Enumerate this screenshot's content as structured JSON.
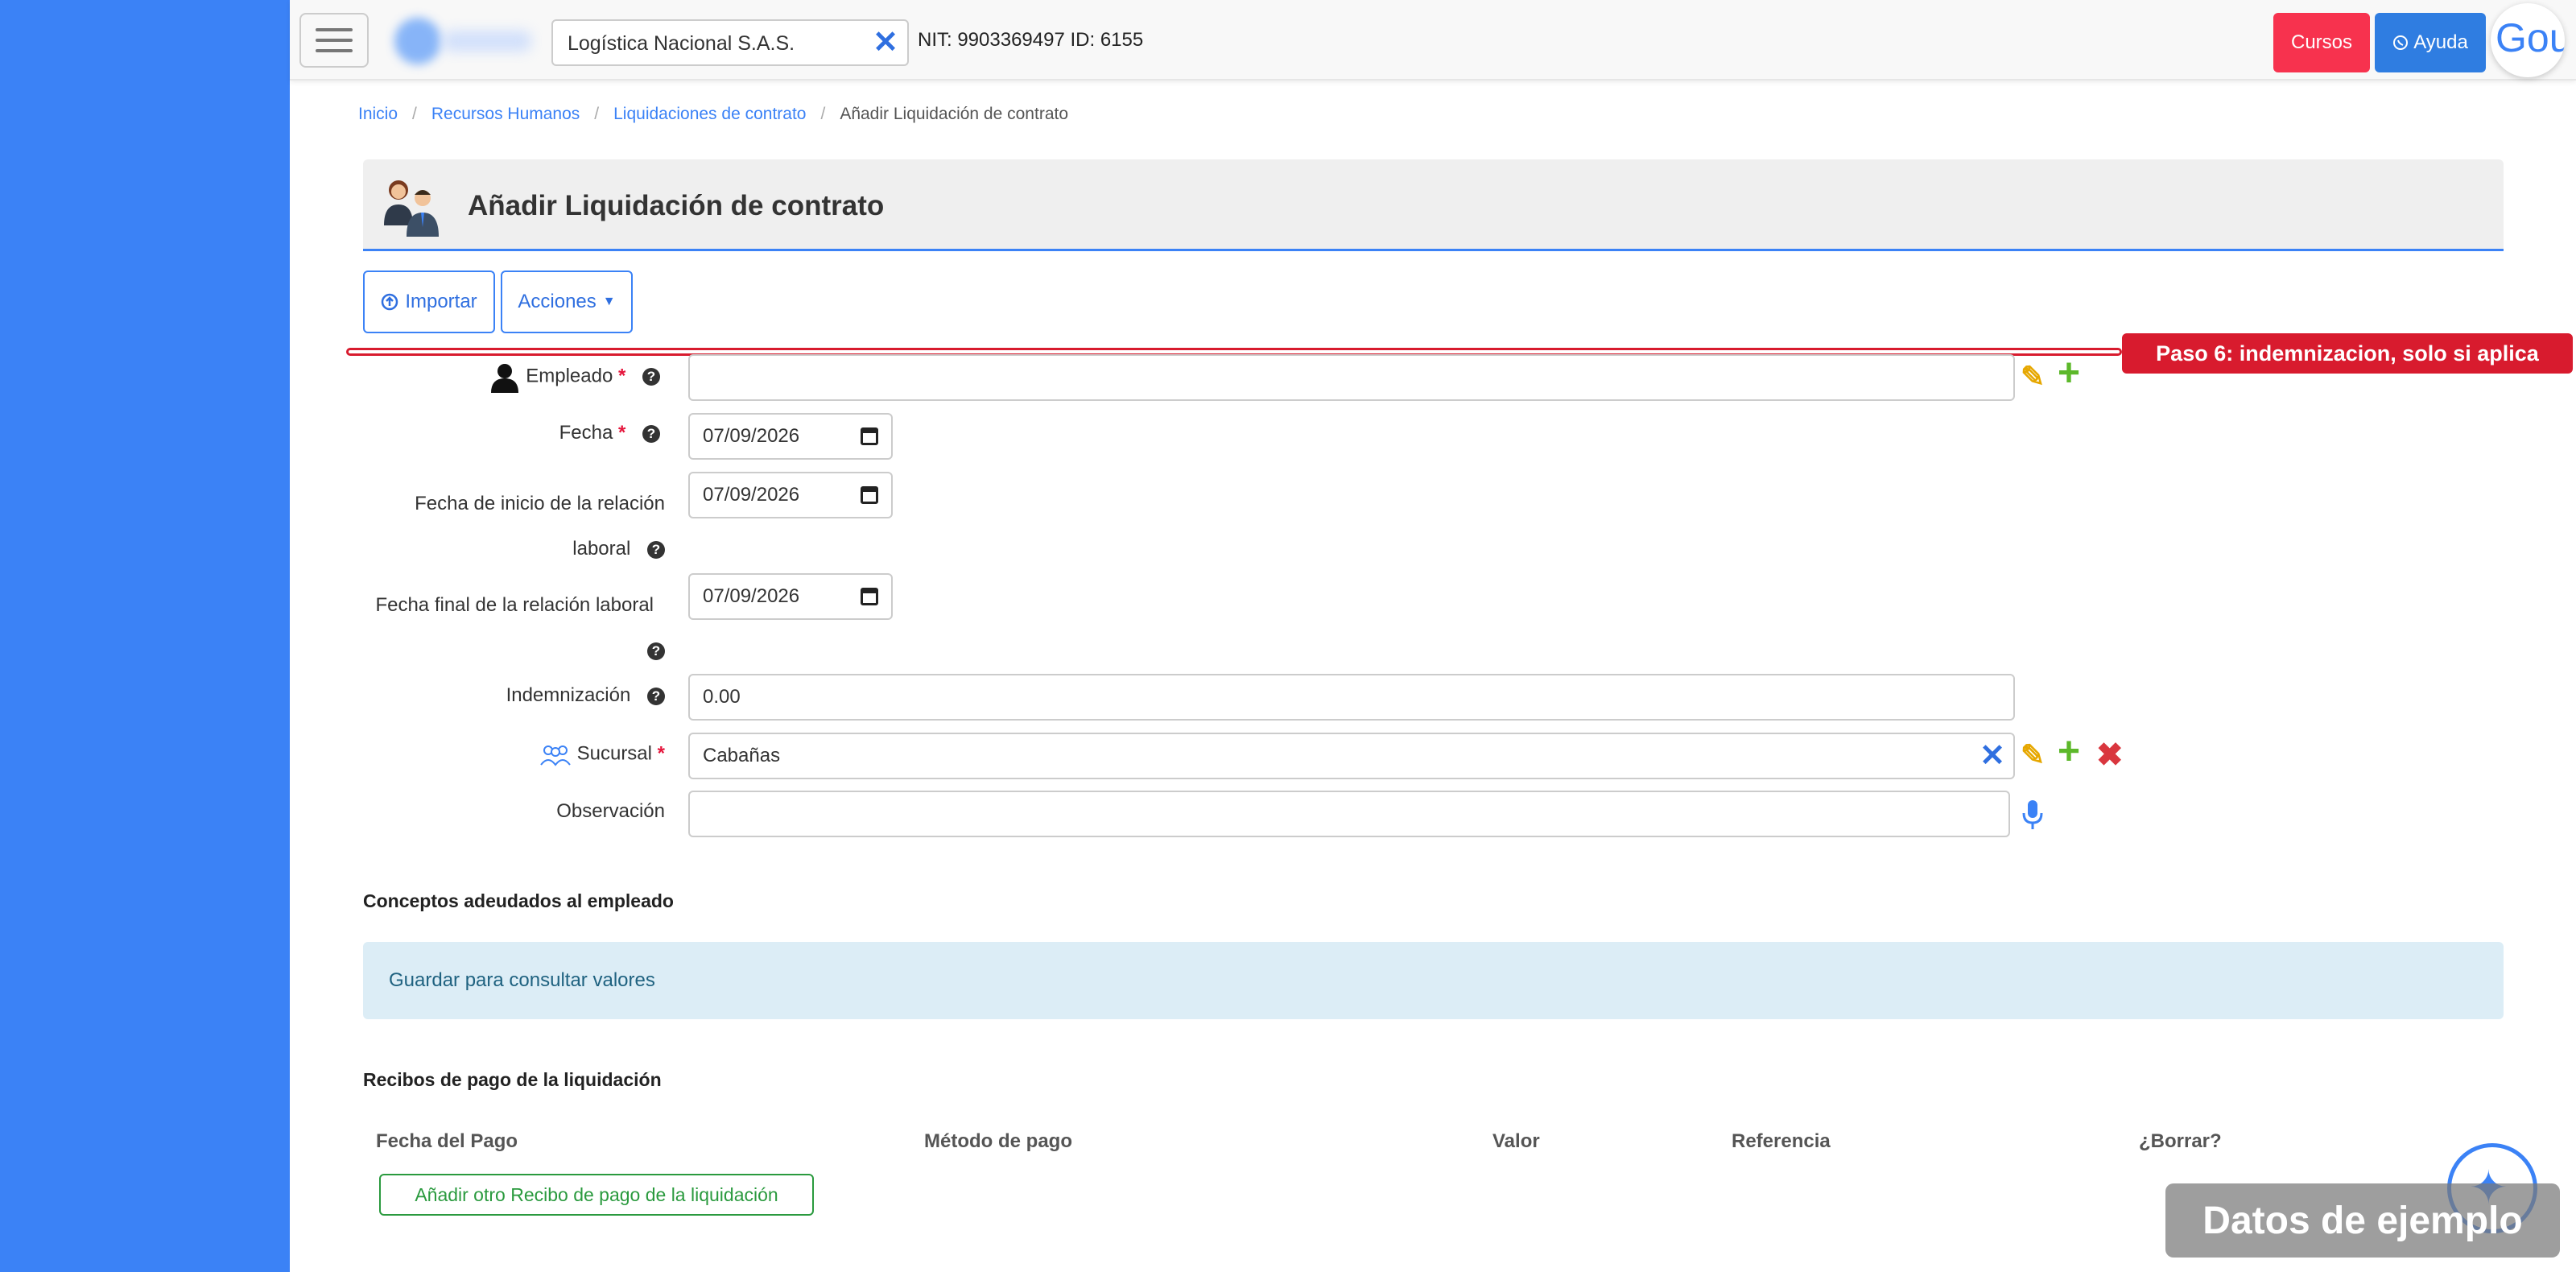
{
  "topbar": {
    "company": "Logística Nacional S.A.S.",
    "nit_id": "NIT: 9903369497 ID: 6155",
    "cursos_label": "Cursos",
    "ayuda_label": "Ayuda",
    "avatar_text": "Gou"
  },
  "breadcrumb": [
    "Inicio",
    "Recursos Humanos",
    "Liquidaciones de contrato",
    "Añadir Liquidación de contrato"
  ],
  "page": {
    "title": "Añadir Liquidación de contrato"
  },
  "actions": {
    "import_label": "Importar",
    "acciones_label": "Acciones"
  },
  "step_hint": "Paso 6: indemnizacion, solo si aplica",
  "form": {
    "empleado": {
      "label": "Empleado",
      "value": ""
    },
    "fecha": {
      "label": "Fecha",
      "value": "07/09/2026"
    },
    "fecha_inicio": {
      "label_line1": "Fecha de inicio de la relación",
      "label_line2": "laboral",
      "value": "07/09/2026"
    },
    "fecha_final": {
      "label": "Fecha final de la relación laboral",
      "value": "07/09/2026"
    },
    "indemnizacion": {
      "label": "Indemnización",
      "value": "0.00"
    },
    "sucursal": {
      "label": "Sucursal",
      "value": "Cabañas"
    },
    "observacion": {
      "label": "Observación",
      "value": ""
    },
    "required_mark": "*"
  },
  "conceptos": {
    "title": "Conceptos adeudados al empleado",
    "info": "Guardar para consultar valores"
  },
  "recibos": {
    "title": "Recibos de pago de la liquidación",
    "columns": [
      "Fecha del Pago",
      "Método de pago",
      "Valor",
      "Referencia",
      "¿Borrar?"
    ],
    "add_label": "Añadir otro Recibo de pago de la liquidación"
  },
  "watermark": "Datos de ejemplo",
  "colors": {
    "sidebar": "#3b82f6",
    "accent": "#3b82f6",
    "danger": "#d81b2e",
    "cursos": "#f7324e"
  }
}
